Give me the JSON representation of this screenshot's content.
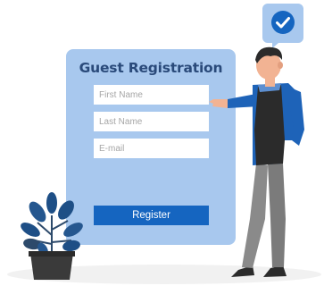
{
  "form": {
    "title": "Guest Registration",
    "fields": {
      "first_name": {
        "placeholder": "First Name",
        "value": ""
      },
      "last_name": {
        "placeholder": "Last Name",
        "value": ""
      },
      "email": {
        "placeholder": "E-mail",
        "value": ""
      }
    },
    "register_label": "Register"
  },
  "illustration": {
    "bubble_icon": "check-circle-icon",
    "person": "person-illustration",
    "plant": "potted-plant-illustration"
  },
  "colors": {
    "card_bg": "#a8c8ee",
    "title": "#2a4a7a",
    "button": "#1565c0",
    "bubble": "#a8c8ee",
    "check_circle": "#1565c0"
  }
}
